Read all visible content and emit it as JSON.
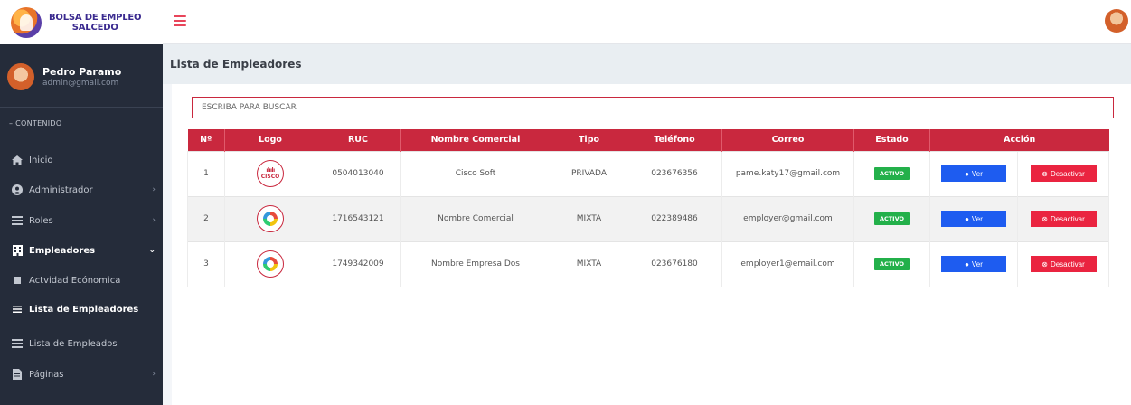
{
  "brand": {
    "line1": "BOLSA DE EMPLEO",
    "line2": "SALCEDO"
  },
  "icons": {
    "menu": "hamburger-icon",
    "avatar": "user-avatar-icon"
  },
  "colors": {
    "accent": "#c9283e",
    "sidebar": "#252c3a",
    "active_badge": "#23b04a",
    "ver_button": "#1e5cf0",
    "desactivar_button": "#ea2440"
  },
  "user": {
    "name": "Pedro Paramo",
    "email": "admin@gmail.com"
  },
  "sidebar": {
    "section": "CONTENIDO",
    "items": [
      {
        "label": "Inicio",
        "icon": "home-icon"
      },
      {
        "label": "Administrador",
        "icon": "user-circle-icon"
      },
      {
        "label": "Roles",
        "icon": "list-icon"
      },
      {
        "label": "Empleadores",
        "icon": "building-icon"
      },
      {
        "label": "Actvidad Ecónomica",
        "icon": "square-icon"
      },
      {
        "label": "Lista de Empleadores",
        "icon": "bars-icon"
      },
      {
        "label": "Lista de Empleados",
        "icon": "list-icon"
      },
      {
        "label": "Páginas",
        "icon": "file-icon"
      }
    ]
  },
  "page": {
    "title": "Lista de Empleadores"
  },
  "search": {
    "placeholder": "ESCRIBA PARA BUSCAR"
  },
  "table": {
    "headers": [
      "Nº",
      "Logo",
      "RUC",
      "Nombre Comercial",
      "Tipo",
      "Teléfono",
      "Correo",
      "Estado",
      "Acción"
    ],
    "rows": [
      {
        "n": "1",
        "logo": "cisco",
        "logo_text": "CISCO",
        "ruc": "0504013040",
        "nombre": "Cisco Soft",
        "tipo": "PRIVADA",
        "telefono": "023676356",
        "correo": "pame.katy17@gmail.com",
        "estado": "ACTIVO"
      },
      {
        "n": "2",
        "logo": "bnv",
        "logo_text": "",
        "ruc": "1716543121",
        "nombre": "Nombre Comercial",
        "tipo": "MIXTA",
        "telefono": "022389486",
        "correo": "employer@gmail.com",
        "estado": "ACTIVO"
      },
      {
        "n": "3",
        "logo": "bnv",
        "logo_text": "",
        "ruc": "1749342009",
        "nombre": "Nombre Empresa Dos",
        "tipo": "MIXTA",
        "telefono": "023676180",
        "correo": "employer1@email.com",
        "estado": "ACTIVO"
      }
    ],
    "actions": {
      "view": "Ver",
      "deactivate": "Desactivar"
    }
  }
}
